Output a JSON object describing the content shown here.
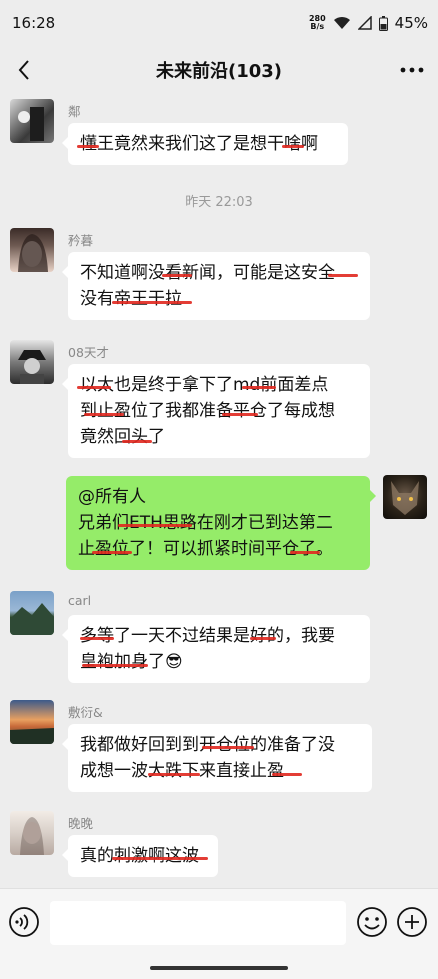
{
  "status": {
    "time": "16:28",
    "netspeed_value": "280",
    "netspeed_unit": "B/s",
    "battery": "45%"
  },
  "header": {
    "title": "未来前沿(103)"
  },
  "messages": [
    {
      "sender": "鄰",
      "lines": [
        "懂王竟然来我们这了是想干啥啊"
      ]
    },
    {
      "timestamp": "昨天 22:03"
    },
    {
      "sender": "矜暮",
      "lines": [
        "不知道啊没看新闻，可能是这安全",
        "没有帝王干拉"
      ]
    },
    {
      "sender": "08天才",
      "lines": [
        "以太也是终于拿下了md前面差点",
        "到止盈位了我都准备平仓了每成想",
        "竟然回头了"
      ]
    },
    {
      "sender": "",
      "lines": [
        "@所有人",
        "兄弟们ETH思路在刚才已到达第二",
        "止盈位了！可以抓紧时间平仓了。"
      ]
    },
    {
      "sender": "carl",
      "lines": [
        "多等了一天不过结果是好的，我要",
        "皇袍加身了😎"
      ]
    },
    {
      "sender": "敷衍&",
      "lines": [
        "我都做好回到到开仓位的准备了没",
        "成想一波大跌下来直接止盈"
      ]
    },
    {
      "sender": "晚晚",
      "lines": [
        "真的刺激啊这波"
      ]
    }
  ],
  "icons": {
    "back": "chevron-left-icon",
    "more": "more-dots-icon",
    "voice": "voice-icon",
    "emoji": "emoji-icon",
    "plus": "plus-icon",
    "wifi": "wifi-icon",
    "signal": "signal-icon",
    "battery": "battery-icon"
  },
  "colors": {
    "background": "#ededed",
    "bubble_self": "#95ec69",
    "bubble_other": "#ffffff",
    "redaction": "#e0281f"
  }
}
